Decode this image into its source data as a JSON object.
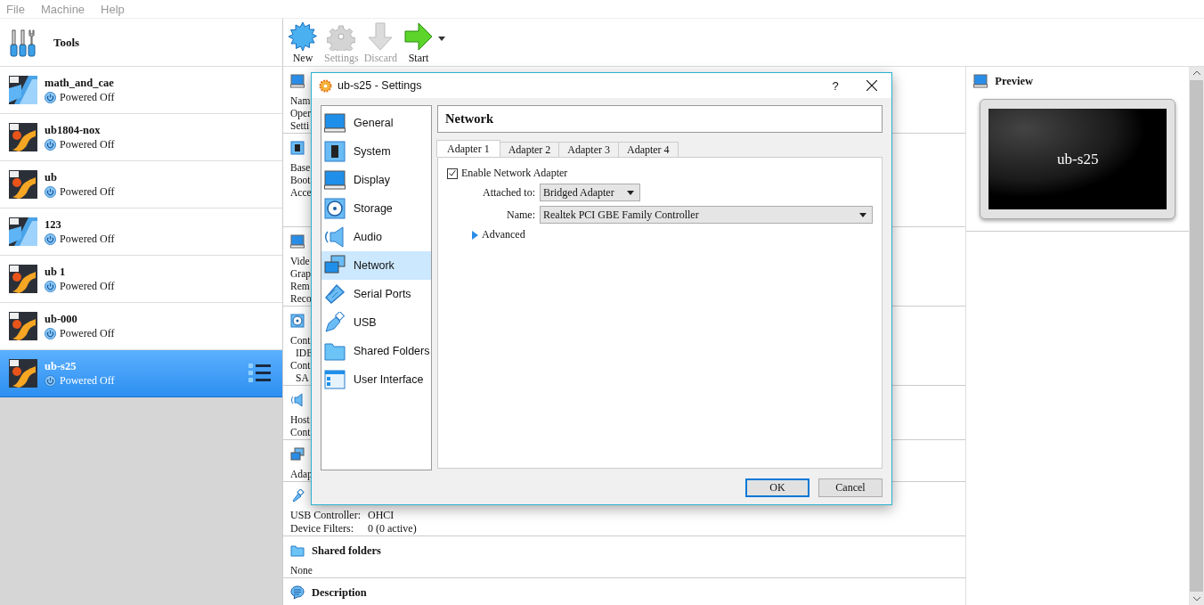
{
  "menu": [
    "File",
    "Machine",
    "Help"
  ],
  "tools": {
    "label": "Tools"
  },
  "vms": [
    {
      "name": "math_and_cae",
      "state": "Powered Off",
      "kind": "windows",
      "selected": false
    },
    {
      "name": "ub1804-nox",
      "state": "Powered Off",
      "kind": "linux",
      "selected": false
    },
    {
      "name": "ub",
      "state": "Powered Off",
      "kind": "linux",
      "selected": false
    },
    {
      "name": "123",
      "state": "Powered Off",
      "kind": "windows",
      "selected": false
    },
    {
      "name": "ub 1",
      "state": "Powered Off",
      "kind": "linux",
      "selected": false
    },
    {
      "name": "ub-000",
      "state": "Powered Off",
      "kind": "linux",
      "selected": false
    },
    {
      "name": "ub-s25",
      "state": "Powered Off",
      "kind": "linux",
      "selected": true
    }
  ],
  "toolbar": [
    {
      "label": "New",
      "kind": "new",
      "disabled": false
    },
    {
      "label": "Settings",
      "kind": "settings",
      "disabled": true
    },
    {
      "label": "Discard",
      "kind": "discard",
      "disabled": true
    },
    {
      "label": "Start",
      "kind": "start",
      "disabled": false
    }
  ],
  "details": [
    {
      "kind": "general",
      "lines": [
        {
          "text": "Nam",
          "indented": false
        },
        {
          "text": "Oper",
          "indented": false
        },
        {
          "text": "Setti",
          "indented": false
        }
      ]
    },
    {
      "kind": "system",
      "lines": [
        {
          "text": "Base",
          "indented": false
        },
        {
          "text": "Boot",
          "indented": false
        },
        {
          "text": "Acce",
          "indented": false
        }
      ]
    },
    {
      "kind": "display",
      "lines": [
        {
          "text": "Vide",
          "indented": false
        },
        {
          "text": "Grap",
          "indented": false
        },
        {
          "text": "Rem",
          "indented": false
        },
        {
          "text": "Reco",
          "indented": false
        }
      ]
    },
    {
      "kind": "storage",
      "lines": [
        {
          "text": "Cont",
          "indented": false
        },
        {
          "text": "IDE",
          "indented": true
        },
        {
          "text": "Cont",
          "indented": false
        },
        {
          "text": "SA",
          "indented": true
        }
      ]
    },
    {
      "kind": "audio",
      "lines": [
        {
          "text": "Host",
          "indented": false
        },
        {
          "text": "Cont",
          "indented": false
        }
      ]
    },
    {
      "kind": "network",
      "lines": [
        {
          "text": "Adap",
          "indented": false
        }
      ]
    },
    {
      "kind": "usb",
      "rows": [
        {
          "label": "USB Controller:",
          "value": "OHCI"
        },
        {
          "label": "Device Filters:",
          "value": "0 (0 active)"
        }
      ]
    },
    {
      "kind": "shared",
      "title": "Shared folders",
      "lines": [
        {
          "text": "None",
          "indented": false
        }
      ]
    },
    {
      "kind": "description",
      "title": "Description"
    }
  ],
  "preview": {
    "title": "Preview",
    "screen_text": "ub-s25"
  },
  "dialog": {
    "title": "ub-s25 - Settings",
    "help": "?",
    "categories": [
      {
        "label": "General",
        "kind": "general",
        "selected": false
      },
      {
        "label": "System",
        "kind": "system",
        "selected": false
      },
      {
        "label": "Display",
        "kind": "display",
        "selected": false
      },
      {
        "label": "Storage",
        "kind": "storage",
        "selected": false
      },
      {
        "label": "Audio",
        "kind": "audio",
        "selected": false
      },
      {
        "label": "Network",
        "kind": "network",
        "selected": true
      },
      {
        "label": "Serial Ports",
        "kind": "serial",
        "selected": false
      },
      {
        "label": "USB",
        "kind": "usb",
        "selected": false
      },
      {
        "label": "Shared Folders",
        "kind": "shared",
        "selected": false
      },
      {
        "label": "User Interface",
        "kind": "ui",
        "selected": false
      }
    ],
    "page_title": "Network",
    "tabs": [
      {
        "label": "Adapter 1",
        "selected": true
      },
      {
        "label": "Adapter 2",
        "selected": false
      },
      {
        "label": "Adapter 3",
        "selected": false
      },
      {
        "label": "Adapter 4",
        "selected": false
      }
    ],
    "enable": {
      "label": "Enable Network Adapter",
      "checked": true
    },
    "attached": {
      "label": "Attached to:",
      "value": "Bridged Adapter"
    },
    "name": {
      "label": "Name:",
      "value": "Realtek PCI GBE Family Controller"
    },
    "advanced": {
      "label": "Advanced",
      "expanded": false
    },
    "buttons": [
      {
        "label": "OK",
        "kind": "default"
      },
      {
        "label": "Cancel",
        "kind": "normal"
      }
    ]
  }
}
